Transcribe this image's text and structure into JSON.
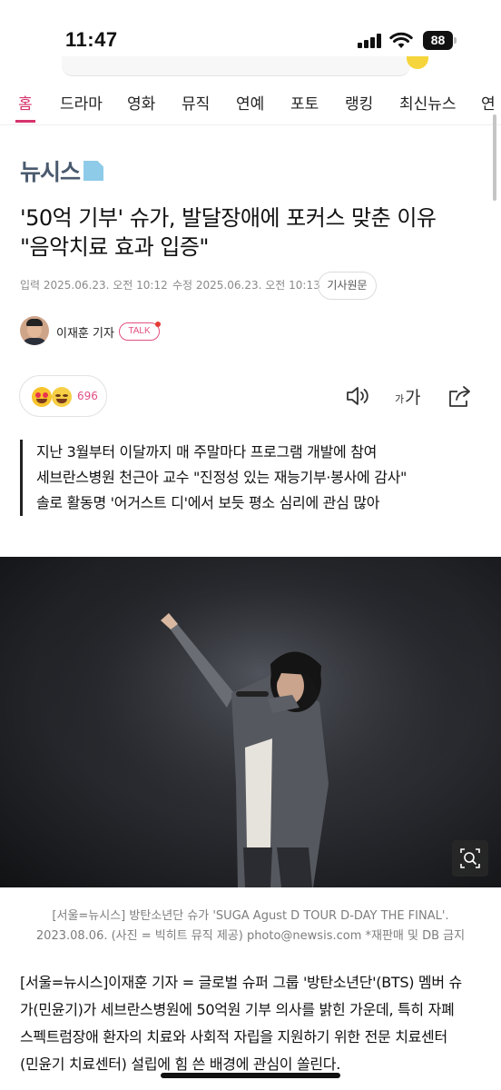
{
  "status_bar": {
    "time": "11:47",
    "battery": "88",
    "icons": [
      "signal-icon",
      "wifi-icon",
      "battery-icon"
    ]
  },
  "nav": {
    "tabs": [
      {
        "label": "홈",
        "active": true
      },
      {
        "label": "드라마",
        "active": false
      },
      {
        "label": "영화",
        "active": false
      },
      {
        "label": "뮤직",
        "active": false
      },
      {
        "label": "연예",
        "active": false
      },
      {
        "label": "포토",
        "active": false
      },
      {
        "label": "랭킹",
        "active": false
      },
      {
        "label": "최신뉴스",
        "active": false
      },
      {
        "label": "연",
        "active": false
      }
    ],
    "active_color": "#d6336c"
  },
  "article": {
    "publisher": "뉴시스",
    "headline_line1": "'50억 기부' 슈가, 발달장애에 포커스 맞춘 이유",
    "headline_line2": "\"음악치료 효과 입증\"",
    "published": "입력 2025.06.23. 오전 10:12",
    "updated": "수정 2025.06.23. 오전 10:13",
    "source_button": "기사원문",
    "author": "이재훈 기자",
    "talk_badge": "TALK",
    "reaction_count": "696",
    "font_icon_small": "가",
    "font_icon_big": "가",
    "summary": [
      "지난 3월부터 이달까지 매 주말마다 프로그램 개발에 참여",
      "세브란스병원 천근아 교수 \"진정성 있는 재능기부·봉사에 감사\"",
      "솔로 활동명 '어거스트 디'에서 보듯 평소 심리에 관심 많아"
    ],
    "caption_line1": "[서울=뉴시스] 방탄소년단 슈가 'SUGA Agust D TOUR D-DAY THE FINAL'.",
    "caption_line2": "2023.08.06. (사진 = 빅히트 뮤직 제공) photo@newsis.com *재판매 및 DB 금지",
    "body": [
      "[서울=뉴시스]이재훈 기자 = 글로벌 슈퍼 그룹 '방탄소년단'(BTS) 멤버 슈",
      "가(민윤기)가 세브란스병원에 50억원 기부 의사를 밝힌 가운데, 특히 자폐",
      "스펙트럼장애 환자의 치료와 사회적 자립을 지원하기 위한 전문 치료센터",
      "(민윤기 치료센터) 설립에 힘 쓴 배경에 관심이 쏠린다."
    ]
  },
  "icons": {
    "reaction": [
      "heart-eyes-emoji-icon",
      "smile-emoji-icon"
    ],
    "tools": [
      "speaker-icon",
      "font-size-icon",
      "share-icon"
    ],
    "photo": "zoom-icon"
  },
  "colors": {
    "accent_pink": "#d6336c",
    "publisher_logo": "#4a5a6e",
    "caption_gray": "#7d7d7d"
  }
}
